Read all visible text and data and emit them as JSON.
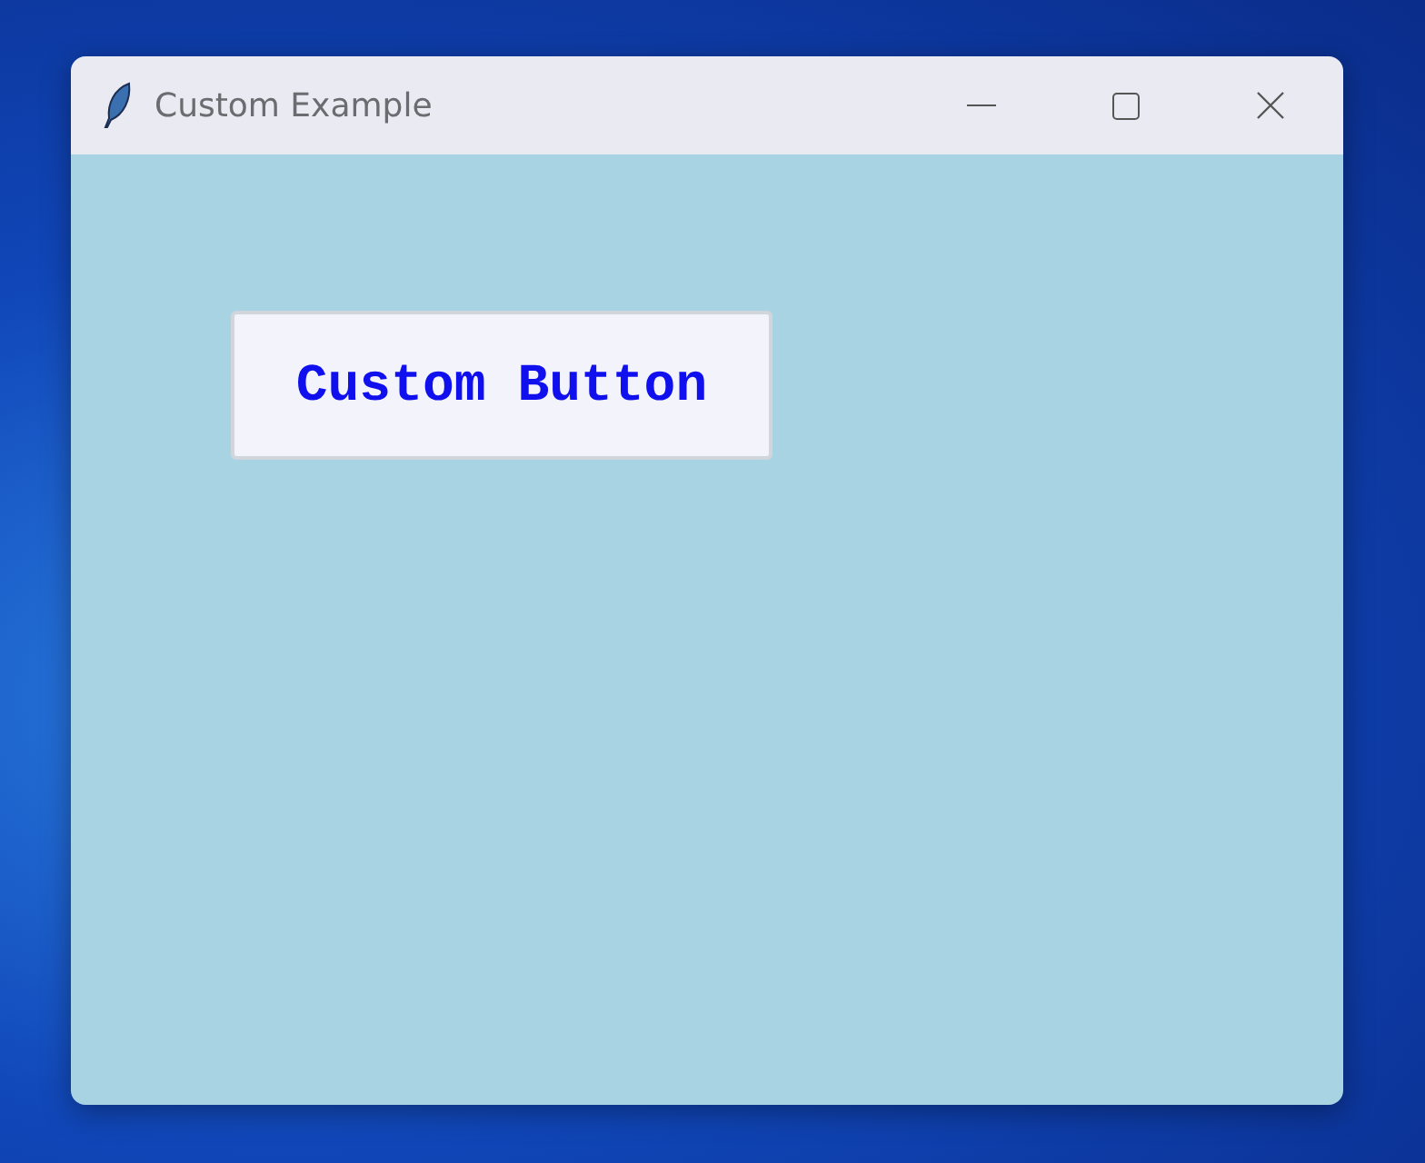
{
  "window": {
    "title": "Custom Example"
  },
  "button": {
    "label": "Custom Button"
  }
}
